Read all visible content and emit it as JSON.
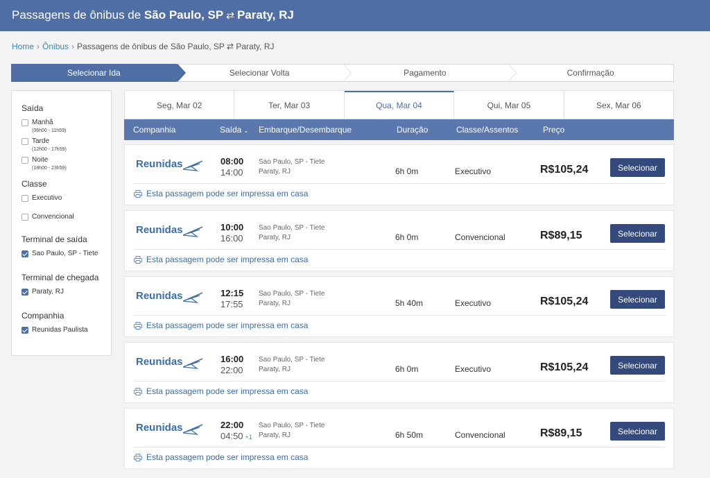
{
  "header": {
    "prefix": "Passagens de ônibus de ",
    "origin": "São Paulo, SP",
    "swap": "⇄",
    "destination": "Paraty, RJ"
  },
  "breadcrumb": {
    "home": "Home",
    "onibus": "Ônibus",
    "current": "Passagens de ônibus de São Paulo, SP ⇄ Paraty, RJ"
  },
  "steps": [
    "Selecionar Ida",
    "Selecionar Volta",
    "Pagamento",
    "Confirmação"
  ],
  "filters": {
    "saida": {
      "title": "Saída",
      "options": [
        {
          "label": "Manhã",
          "sub": "(06h00 - 11h59)",
          "checked": false
        },
        {
          "label": "Tarde",
          "sub": "(12h00 - 17h59)",
          "checked": false
        },
        {
          "label": "Noite",
          "sub": "(18h00 - 23h59)",
          "checked": false
        }
      ]
    },
    "classe": {
      "title": "Classe",
      "options": [
        {
          "label": "Executivo",
          "checked": false
        },
        {
          "label": "Convencional",
          "checked": false
        }
      ]
    },
    "terminal_saida": {
      "title": "Terminal de saída",
      "option": "Sao Paulo, SP - Tiete",
      "checked": true
    },
    "terminal_chegada": {
      "title": "Terminal de chegada",
      "option": "Paraty, RJ",
      "checked": true
    },
    "companhia": {
      "title": "Companhia",
      "option": "Reunidas Paulista",
      "checked": true
    }
  },
  "dates": [
    "Seg, Mar 02",
    "Ter, Mar 03",
    "Qua, Mar 04",
    "Qui, Mar 05",
    "Sex, Mar 06"
  ],
  "active_date": 2,
  "table_headers": {
    "company": "Companhia",
    "departure": "Saída",
    "boarding": "Embarque/Desembarque",
    "duration": "Duração",
    "class": "Classe/Assentos",
    "price": "Preço"
  },
  "trips": [
    {
      "company": "Reunidas",
      "dep": "08:00",
      "arr": "14:00",
      "next_day": "",
      "from": "Sao Paulo, SP - Tiete",
      "to": "Paraty, RJ",
      "duration": "6h 0m",
      "class": "Executivo",
      "price": "R$105,24",
      "button": "Selecionar",
      "print": "Esta passagem pode ser impressa em casa"
    },
    {
      "company": "Reunidas",
      "dep": "10:00",
      "arr": "16:00",
      "next_day": "",
      "from": "Sao Paulo, SP - Tiete",
      "to": "Paraty, RJ",
      "duration": "6h 0m",
      "class": "Convencional",
      "price": "R$89,15",
      "button": "Selecionar",
      "print": "Esta passagem pode ser impressa em casa"
    },
    {
      "company": "Reunidas",
      "dep": "12:15",
      "arr": "17:55",
      "next_day": "",
      "from": "Sao Paulo, SP - Tiete",
      "to": "Paraty, RJ",
      "duration": "5h 40m",
      "class": "Executivo",
      "price": "R$105,24",
      "button": "Selecionar",
      "print": "Esta passagem pode ser impressa em casa"
    },
    {
      "company": "Reunidas",
      "dep": "16:00",
      "arr": "22:00",
      "next_day": "",
      "from": "Sao Paulo, SP - Tiete",
      "to": "Paraty, RJ",
      "duration": "6h 0m",
      "class": "Executivo",
      "price": "R$105,24",
      "button": "Selecionar",
      "print": "Esta passagem pode ser impressa em casa"
    },
    {
      "company": "Reunidas",
      "dep": "22:00",
      "arr": "04:50",
      "next_day": "+1",
      "from": "Sao Paulo, SP - Tiete",
      "to": "Paraty, RJ",
      "duration": "6h 50m",
      "class": "Convencional",
      "price": "R$89,15",
      "button": "Selecionar",
      "print": "Esta passagem pode ser impressa em casa"
    }
  ],
  "colors": {
    "primary": "#4f6ea5",
    "button": "#354a7c",
    "link": "#3b6ea6"
  }
}
